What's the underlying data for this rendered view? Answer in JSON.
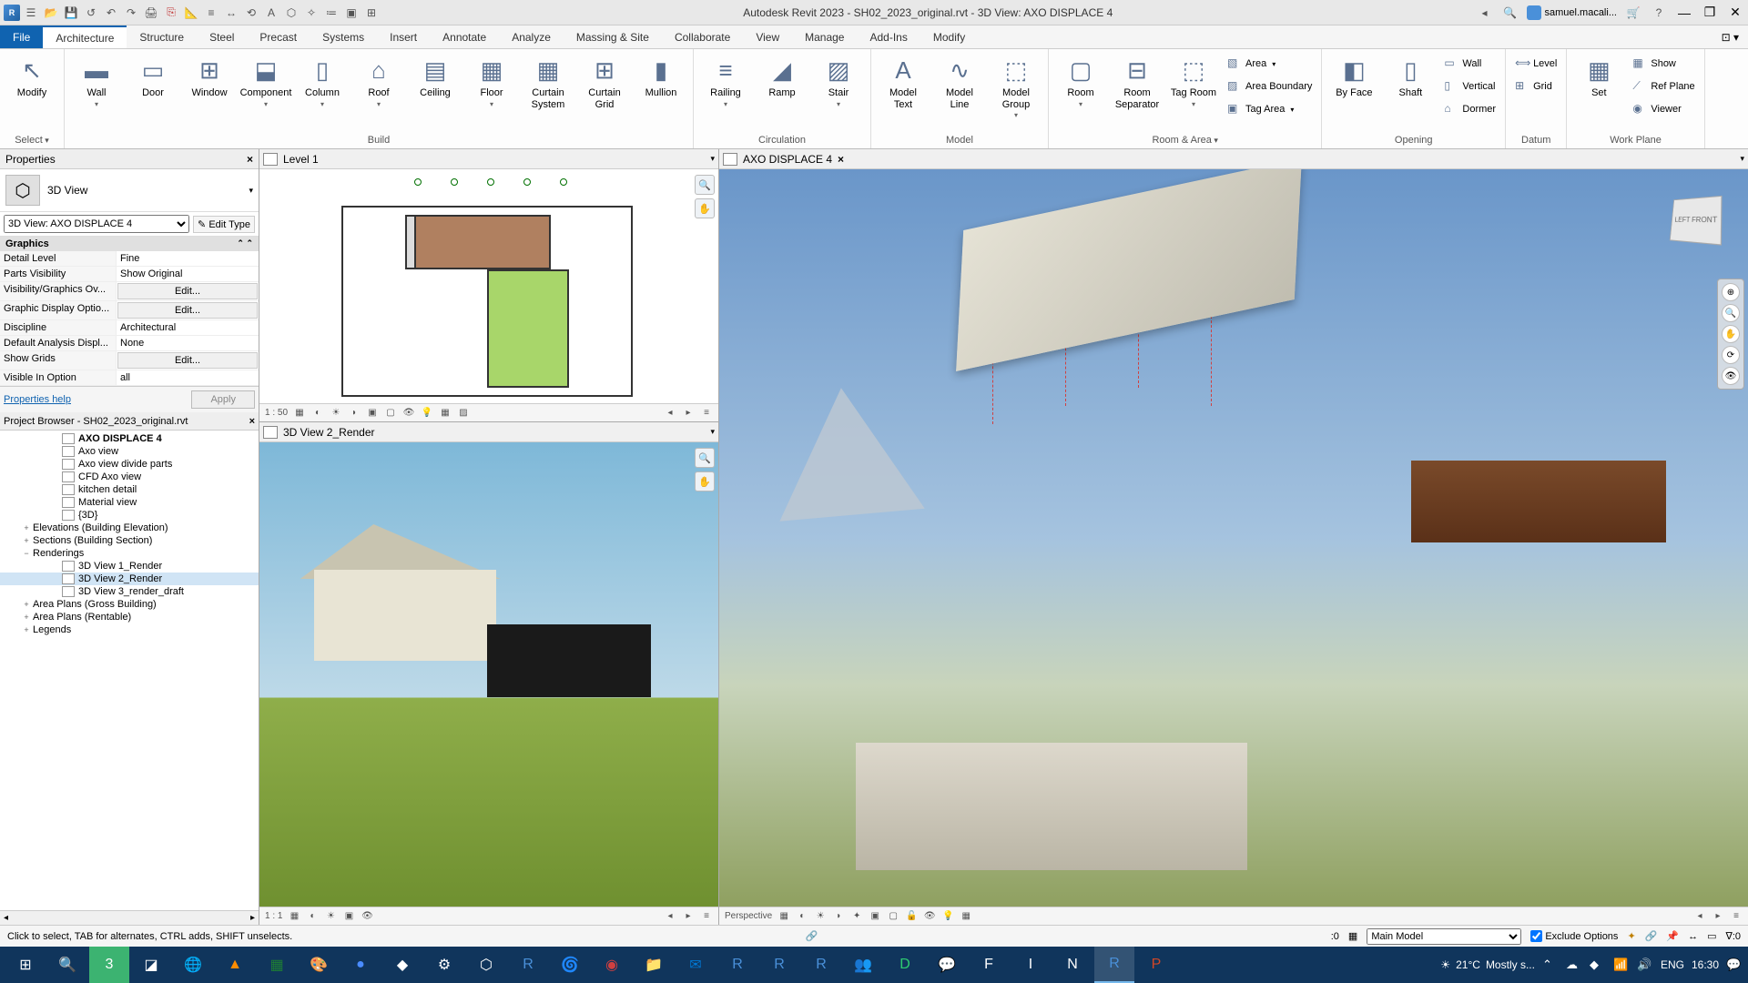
{
  "title": "Autodesk Revit 2023 - SH02_2023_original.rvt - 3D View: AXO DISPLACE 4",
  "user": "samuel.macali...",
  "ribbon_tabs": [
    "File",
    "Architecture",
    "Structure",
    "Steel",
    "Precast",
    "Systems",
    "Insert",
    "Annotate",
    "Analyze",
    "Massing & Site",
    "Collaborate",
    "View",
    "Manage",
    "Add-Ins",
    "Modify"
  ],
  "ribbon_active": 1,
  "qat": {
    "select_label": "Select"
  },
  "panels": {
    "modify": {
      "title": "",
      "modify": "Modify",
      "select": "Select"
    },
    "build": {
      "title": "Build",
      "items": [
        "Wall",
        "Door",
        "Window",
        "Component",
        "Column",
        "Roof",
        "Ceiling",
        "Floor",
        "Curtain System",
        "Curtain Grid",
        "Mullion"
      ]
    },
    "circulation": {
      "title": "Circulation",
      "items": [
        "Railing",
        "Ramp",
        "Stair"
      ]
    },
    "model": {
      "title": "Model",
      "items": [
        "Model Text",
        "Model Line",
        "Model Group"
      ]
    },
    "room_area": {
      "title": "Room & Area",
      "room": "Room",
      "sep": "Room Separator",
      "tag": "Tag Room",
      "area": "Area",
      "boundary": "Area Boundary",
      "tag_area": "Tag Area"
    },
    "opening": {
      "title": "Opening",
      "face": "By Face",
      "shaft": "Shaft",
      "wall": "Wall",
      "vertical": "Vertical",
      "dormer": "Dormer"
    },
    "datum": {
      "title": "Datum",
      "level": "Level",
      "grid": "Grid"
    },
    "workplane": {
      "title": "Work Plane",
      "set": "Set",
      "show": "Show",
      "ref": "Ref Plane",
      "viewer": "Viewer"
    }
  },
  "properties": {
    "title": "Properties",
    "type": "3D View",
    "instance": "3D View: AXO DISPLACE 4",
    "edit_type": "Edit Type",
    "group": "Graphics",
    "rows": [
      {
        "k": "Detail Level",
        "v": "Fine",
        "t": "text"
      },
      {
        "k": "Parts Visibility",
        "v": "Show Original",
        "t": "text"
      },
      {
        "k": "Visibility/Graphics Ov...",
        "v": "Edit...",
        "t": "btn"
      },
      {
        "k": "Graphic Display Optio...",
        "v": "Edit...",
        "t": "btn"
      },
      {
        "k": "Discipline",
        "v": "Architectural",
        "t": "text"
      },
      {
        "k": "Default Analysis Displ...",
        "v": "None",
        "t": "text"
      },
      {
        "k": "Show Grids",
        "v": "Edit...",
        "t": "btn"
      },
      {
        "k": "Visible In Option",
        "v": "all",
        "t": "text"
      }
    ],
    "help": "Properties help",
    "apply": "Apply"
  },
  "browser": {
    "title": "Project Browser - SH02_2023_original.rvt",
    "items": [
      {
        "lvl": 3,
        "label": "AXO DISPLACE 4",
        "bold": true
      },
      {
        "lvl": 3,
        "label": "Axo view"
      },
      {
        "lvl": 3,
        "label": "Axo view divide parts"
      },
      {
        "lvl": 3,
        "label": "CFD Axo view"
      },
      {
        "lvl": 3,
        "label": "kitchen detail"
      },
      {
        "lvl": 3,
        "label": "Material view"
      },
      {
        "lvl": 3,
        "label": "{3D}"
      },
      {
        "lvl": 1,
        "exp": "+",
        "label": "Elevations (Building Elevation)"
      },
      {
        "lvl": 1,
        "exp": "+",
        "label": "Sections (Building Section)"
      },
      {
        "lvl": 1,
        "exp": "−",
        "label": "Renderings"
      },
      {
        "lvl": 3,
        "label": "3D View 1_Render"
      },
      {
        "lvl": 3,
        "label": "3D View 2_Render",
        "sel": true
      },
      {
        "lvl": 3,
        "label": "3D View 3_render_draft"
      },
      {
        "lvl": 1,
        "exp": "+",
        "label": "Area Plans (Gross Building)"
      },
      {
        "lvl": 1,
        "exp": "+",
        "label": "Area Plans (Rentable)"
      },
      {
        "lvl": 1,
        "exp": "+",
        "label": "Legends"
      }
    ]
  },
  "views": {
    "plan": {
      "tab": "Level 1",
      "scale": "1 : 50"
    },
    "render": {
      "tab": "3D View 2_Render",
      "scale": "1 : 1"
    },
    "axo": {
      "tab": "AXO DISPLACE 4",
      "scale": "Perspective",
      "cube": "LEFT FRONT"
    }
  },
  "status": {
    "hint": "Click to select, TAB for alternates, CTRL adds, SHIFT unselects.",
    "n": ":0",
    "model": "Main Model",
    "exclude": "Exclude Options",
    "filter": "∇:0"
  },
  "taskbar": {
    "weather_temp": "21°C",
    "weather_text": "Mostly s...",
    "lang": "ENG",
    "time": "16:30"
  }
}
